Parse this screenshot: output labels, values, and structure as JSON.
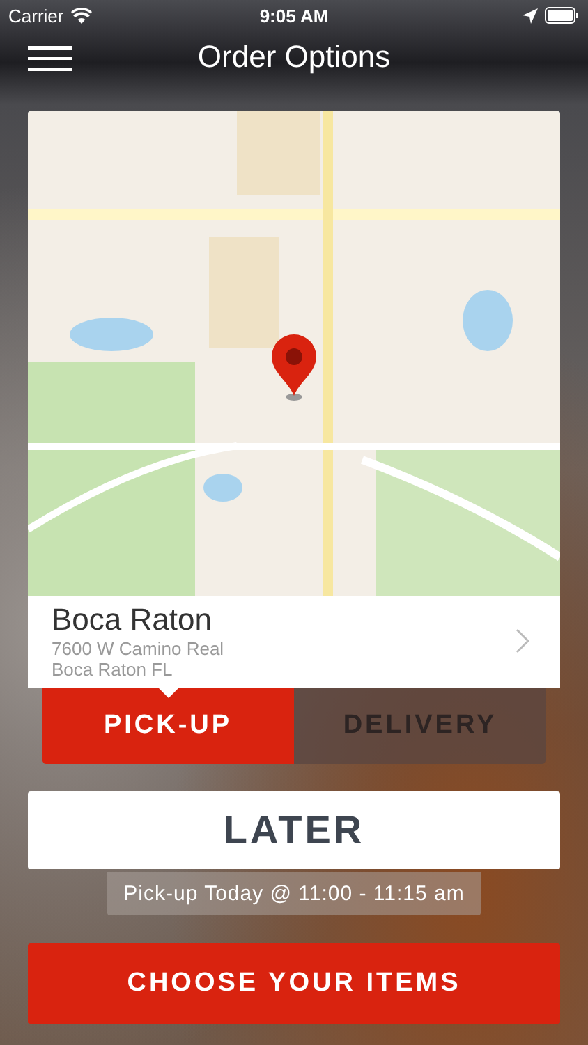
{
  "status_bar": {
    "carrier": "Carrier",
    "time": "9:05 AM"
  },
  "nav": {
    "title": "Order Options"
  },
  "location": {
    "name": "Boca Raton",
    "address_line_1": "7600 W Camino Real",
    "address_line_2": "Boca Raton FL"
  },
  "modes": [
    {
      "label": "PICK-UP",
      "selected": true
    },
    {
      "label": "DELIVERY",
      "selected": false
    }
  ],
  "time_button": "LATER",
  "time_note": "Pick-up Today @ 11:00 - 11:15 am",
  "primary_button": "CHOOSE YOUR ITEMS"
}
